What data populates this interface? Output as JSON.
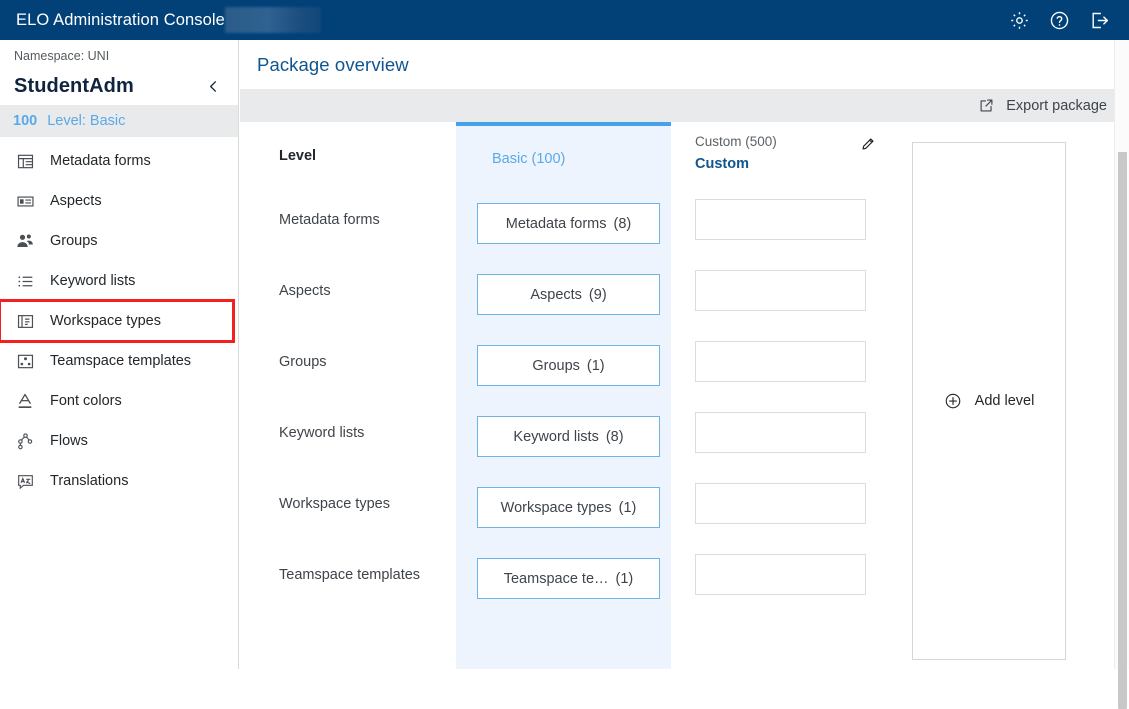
{
  "topbar": {
    "app_title": "ELO Administration Console",
    "blurred_badge": "",
    "actions": [
      {
        "name": "settings",
        "icon": "gear-icon"
      },
      {
        "name": "help",
        "icon": "question-circle-icon"
      },
      {
        "name": "logout",
        "icon": "logout-icon"
      }
    ],
    "background_color": "#014178"
  },
  "sidebar": {
    "namespace_label": "Namespace: UNI",
    "namespace_name": "StudentAdm",
    "collapse_icon": "chevron-left-icon",
    "level_row": {
      "number": "100",
      "label": "Level: Basic",
      "accent_color": "#5aa9e8"
    },
    "items": [
      {
        "label": "Metadata forms",
        "icon": "table-icon",
        "highlighted": false
      },
      {
        "label": "Aspects",
        "icon": "card-icon",
        "highlighted": false
      },
      {
        "label": "Groups",
        "icon": "people-icon",
        "highlighted": false
      },
      {
        "label": "Keyword lists",
        "icon": "list-icon",
        "highlighted": false
      },
      {
        "label": "Workspace types",
        "icon": "workspace-icon",
        "highlighted": true
      },
      {
        "label": "Teamspace templates",
        "icon": "teamspace-icon",
        "highlighted": false
      },
      {
        "label": "Font colors",
        "icon": "font-color-icon",
        "highlighted": false
      },
      {
        "label": "Flows",
        "icon": "flow-icon",
        "highlighted": false
      },
      {
        "label": "Translations",
        "icon": "translate-icon",
        "highlighted": false
      }
    ],
    "highlight_color": "#f61f1f"
  },
  "main": {
    "title": "Package overview",
    "toolbar": {
      "export_label": "Export package",
      "export_icon": "external-link-icon"
    },
    "columns": {
      "labels": {
        "header": "Level",
        "rows": [
          "Metadata forms",
          "Aspects",
          "Groups",
          "Keyword lists",
          "Workspace types",
          "Teamspace templates"
        ]
      },
      "basic": {
        "header": "Basic (100)",
        "accent_color": "#45a1ea",
        "background_color": "#edf4fd",
        "chips": [
          {
            "label": "Metadata forms",
            "count": "(8)"
          },
          {
            "label": "Aspects",
            "count": "(9)"
          },
          {
            "label": "Groups",
            "count": "(1)"
          },
          {
            "label": "Keyword lists",
            "count": "(8)"
          },
          {
            "label": "Workspace types",
            "count": "(1)"
          },
          {
            "label": "Teamspace te…",
            "count": "(1)"
          }
        ]
      },
      "custom": {
        "header_sub": "Custom (500)",
        "header_name": "Custom",
        "edit_icon": "pencil-icon",
        "slots": [
          "",
          "",
          "",
          "",
          "",
          ""
        ]
      },
      "add": {
        "label": "Add level",
        "icon": "plus-circle-icon"
      }
    }
  }
}
